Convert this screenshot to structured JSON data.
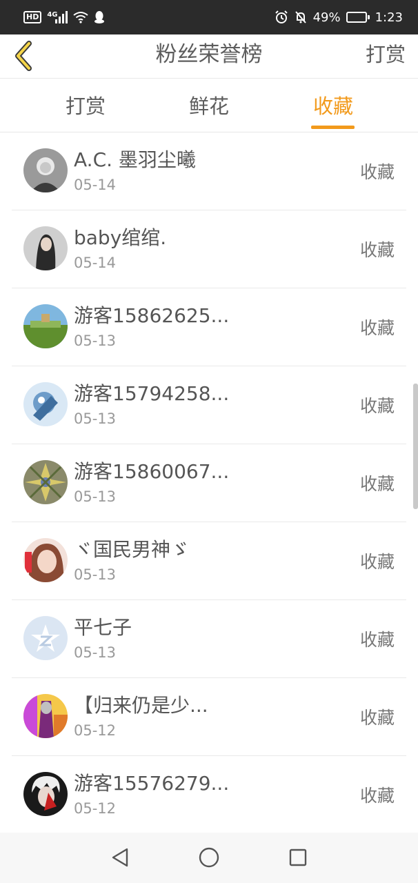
{
  "status_bar": {
    "hd": "HD",
    "network": "4G",
    "battery_percent": "49%",
    "battery_level": 0.49,
    "time": "1:23"
  },
  "header": {
    "title": "粉丝荣誉榜",
    "action_label": "打赏",
    "back_icon": "chevron-left-icon"
  },
  "tabs": [
    {
      "label": "打赏",
      "active": false
    },
    {
      "label": "鲜花",
      "active": false
    },
    {
      "label": "收藏",
      "active": true
    }
  ],
  "accent_color": "#f29a1c",
  "fans": [
    {
      "name": "A.C. 墨羽尘曦",
      "date": "05-14",
      "action": "收藏"
    },
    {
      "name": "baby绾绾.",
      "date": "05-14",
      "action": "收藏"
    },
    {
      "name": "游客15862625...",
      "date": "05-13",
      "action": "收藏"
    },
    {
      "name": "游客15794258...",
      "date": "05-13",
      "action": "收藏"
    },
    {
      "name": "游客15860067...",
      "date": "05-13",
      "action": "收藏"
    },
    {
      "name": "ヾ国民男神ゞ",
      "date": "05-13",
      "action": "收藏"
    },
    {
      "name": "平七子",
      "date": "05-13",
      "action": "收藏"
    },
    {
      "name": "【归来仍是少...",
      "date": "05-12",
      "action": "收藏"
    },
    {
      "name": "游客15576279...",
      "date": "05-12",
      "action": "收藏"
    }
  ],
  "nav_bar": {
    "back": "triangle-back-icon",
    "home": "circle-home-icon",
    "recents": "square-recents-icon"
  }
}
